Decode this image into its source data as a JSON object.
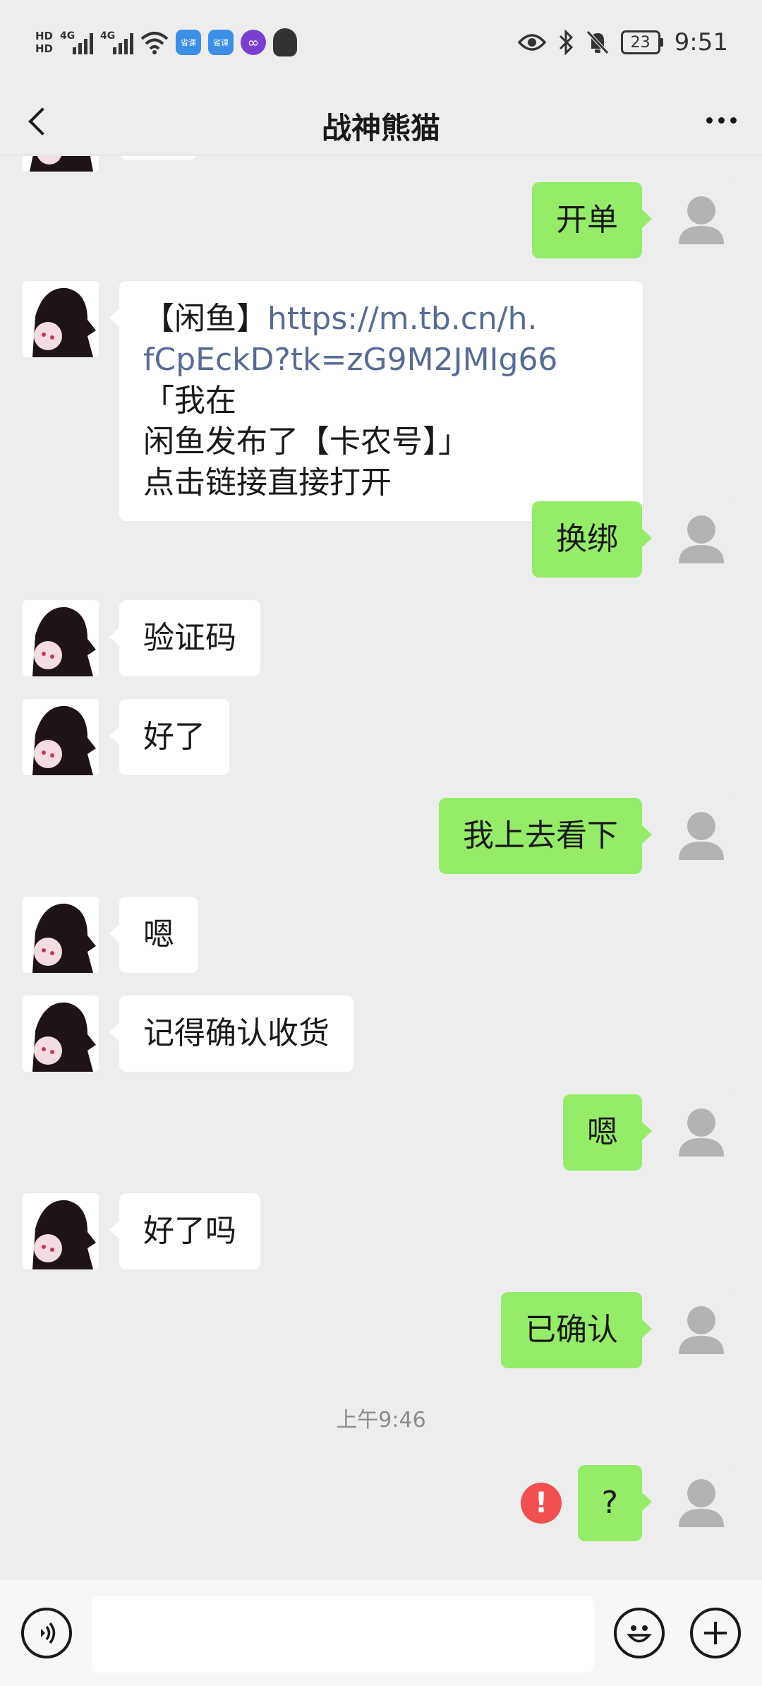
{
  "status_bar": {
    "hd_top": "HD",
    "hd_bottom": "HD",
    "network_1": "4G",
    "network_2": "4G",
    "app_badge_1": "省课",
    "app_badge_2": "省课",
    "battery": "23",
    "time": "9:51"
  },
  "header": {
    "title": "战神熊猫"
  },
  "messages": [
    {
      "from": "me",
      "text": "开单"
    },
    {
      "from": "them",
      "prefix": "【闲鱼】",
      "link": "https://m.tb.cn/h.fCpEckD?tk=zG9M2JMIg66",
      "suffix": "「我在闲鱼发布了【卡农号】」",
      "line4": "点击链接直接打开"
    },
    {
      "from": "me",
      "text": "换绑"
    },
    {
      "from": "them",
      "text": "验证码"
    },
    {
      "from": "them",
      "text": "好了"
    },
    {
      "from": "me",
      "text": "我上去看下"
    },
    {
      "from": "them",
      "text": "嗯"
    },
    {
      "from": "them",
      "text": "记得确认收货"
    },
    {
      "from": "me",
      "text": "嗯"
    },
    {
      "from": "them",
      "text": "好了吗"
    },
    {
      "from": "me",
      "text": "已确认"
    },
    {
      "from": "me",
      "text": "?",
      "failed": true
    }
  ],
  "link_lines": {
    "line1_link": "https://m.tb.cn/h.",
    "line2_link": "fCpEckD?tk=zG9M2JMIg66",
    "line2_text": "「我在",
    "line3": "闲鱼发布了【卡农号】」"
  },
  "timestamp": "上午9:46",
  "error_mark": "!",
  "input": {
    "value": "",
    "placeholder": ""
  },
  "icons": {
    "back": "chevron-left-icon",
    "more": "more-dots-icon",
    "voice": "voice-icon",
    "emoji": "emoji-icon",
    "plus": "plus-icon",
    "avatar_default": "default-avatar-icon"
  },
  "colors": {
    "my_bubble": "#95ec69",
    "their_bubble": "#ffffff",
    "link": "#576b95",
    "background": "#ededed",
    "error": "#f05050"
  }
}
